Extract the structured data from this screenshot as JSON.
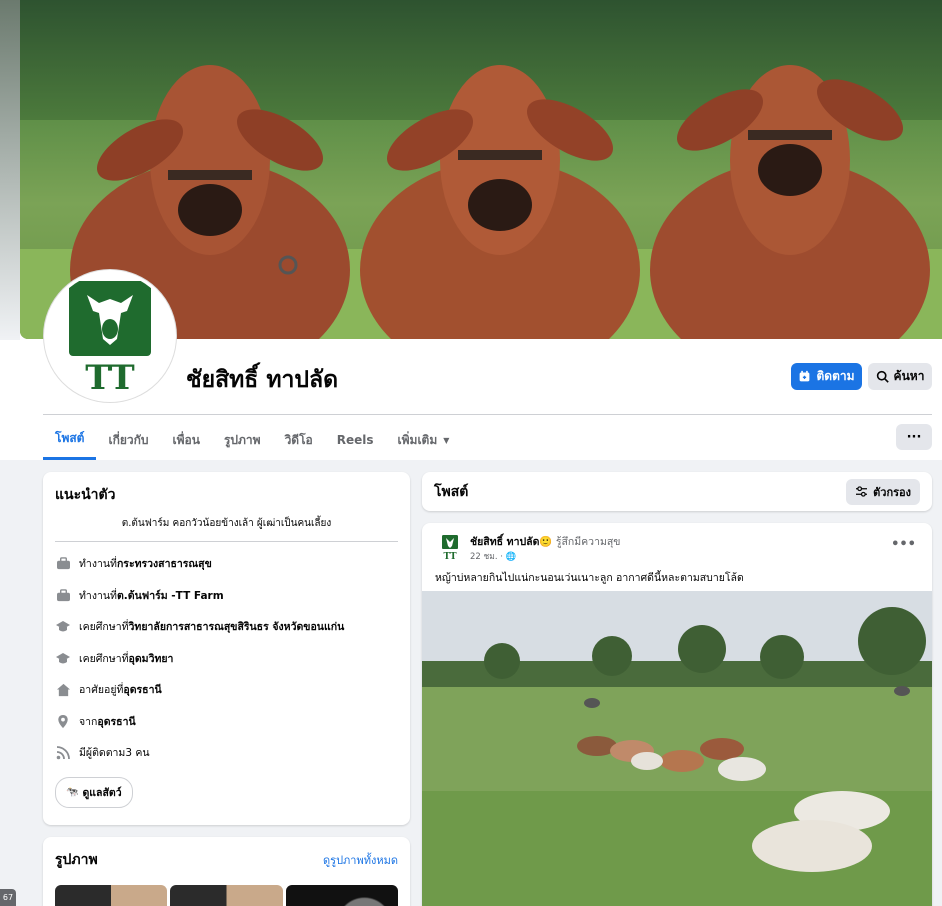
{
  "profile": {
    "name": "ชัยสิทธิ์ ทาปลัด",
    "avatar_text": "TT"
  },
  "actions": {
    "follow_label": "ติดตาม",
    "search_label": "ค้นหา",
    "more_label": "···"
  },
  "tabs": [
    {
      "label": "โพสต์",
      "active": true
    },
    {
      "label": "เกี่ยวกับ"
    },
    {
      "label": "เพื่อน"
    },
    {
      "label": "รูปภาพ"
    },
    {
      "label": "วิดีโอ"
    },
    {
      "label": "Reels"
    },
    {
      "label": "เพิ่มเติม"
    }
  ],
  "intro": {
    "title": "แนะนำตัว",
    "bio": "ต.ต้นฟาร์ม คอกวัวน้อยข้างเล้า ผู้เฒ่าเป็นคนเลี้ยง",
    "items": [
      {
        "icon": "briefcase-icon",
        "prefix": "ทำงานที่ ",
        "value": "กระทรวงสาธารณสุข"
      },
      {
        "icon": "briefcase-icon",
        "prefix": "ทำงานที่ ",
        "value": "ต.ต้นฟาร์ม -TT Farm"
      },
      {
        "icon": "graduation-cap-icon",
        "prefix": "เคยศึกษาที่ ",
        "value": "วิทยาลัยการสาธารณสุขสิรินธร จังหวัดขอนแก่น"
      },
      {
        "icon": "graduation-cap-icon",
        "prefix": "เคยศึกษาที่ ",
        "value": "อุดมวิทยา"
      },
      {
        "icon": "home-icon",
        "prefix": "อาศัยอยู่ที่ ",
        "value": "อุดรธานี"
      },
      {
        "icon": "location-pin-icon",
        "prefix": "จาก ",
        "value": "อุดรธานี"
      },
      {
        "icon": "rss-icon",
        "prefix": "มีผู้ติดตาม ",
        "value": "3 คน"
      }
    ],
    "chip_label": "ดูแลสัตว์"
  },
  "photos": {
    "title": "รูปภาพ",
    "see_all": "ดูรูปภาพทั้งหมด"
  },
  "posts": {
    "title": "โพสต์",
    "filter_label": "ตัวกรอง"
  },
  "post": {
    "author": "ชัยสิทธิ์ ทาปลัด",
    "feeling": "🙂 รู้สึกมีความสุข",
    "time": "22 ชม. · ",
    "text": "หญ้าบ่หลายกินไปแน่กะนอนเว่นเนาะลูก อากาศดีนี้หละตามสบายโล้ด"
  },
  "side_badge": "67",
  "colors": {
    "accent": "#1b74e4",
    "logo_green": "#1f6b2e"
  }
}
